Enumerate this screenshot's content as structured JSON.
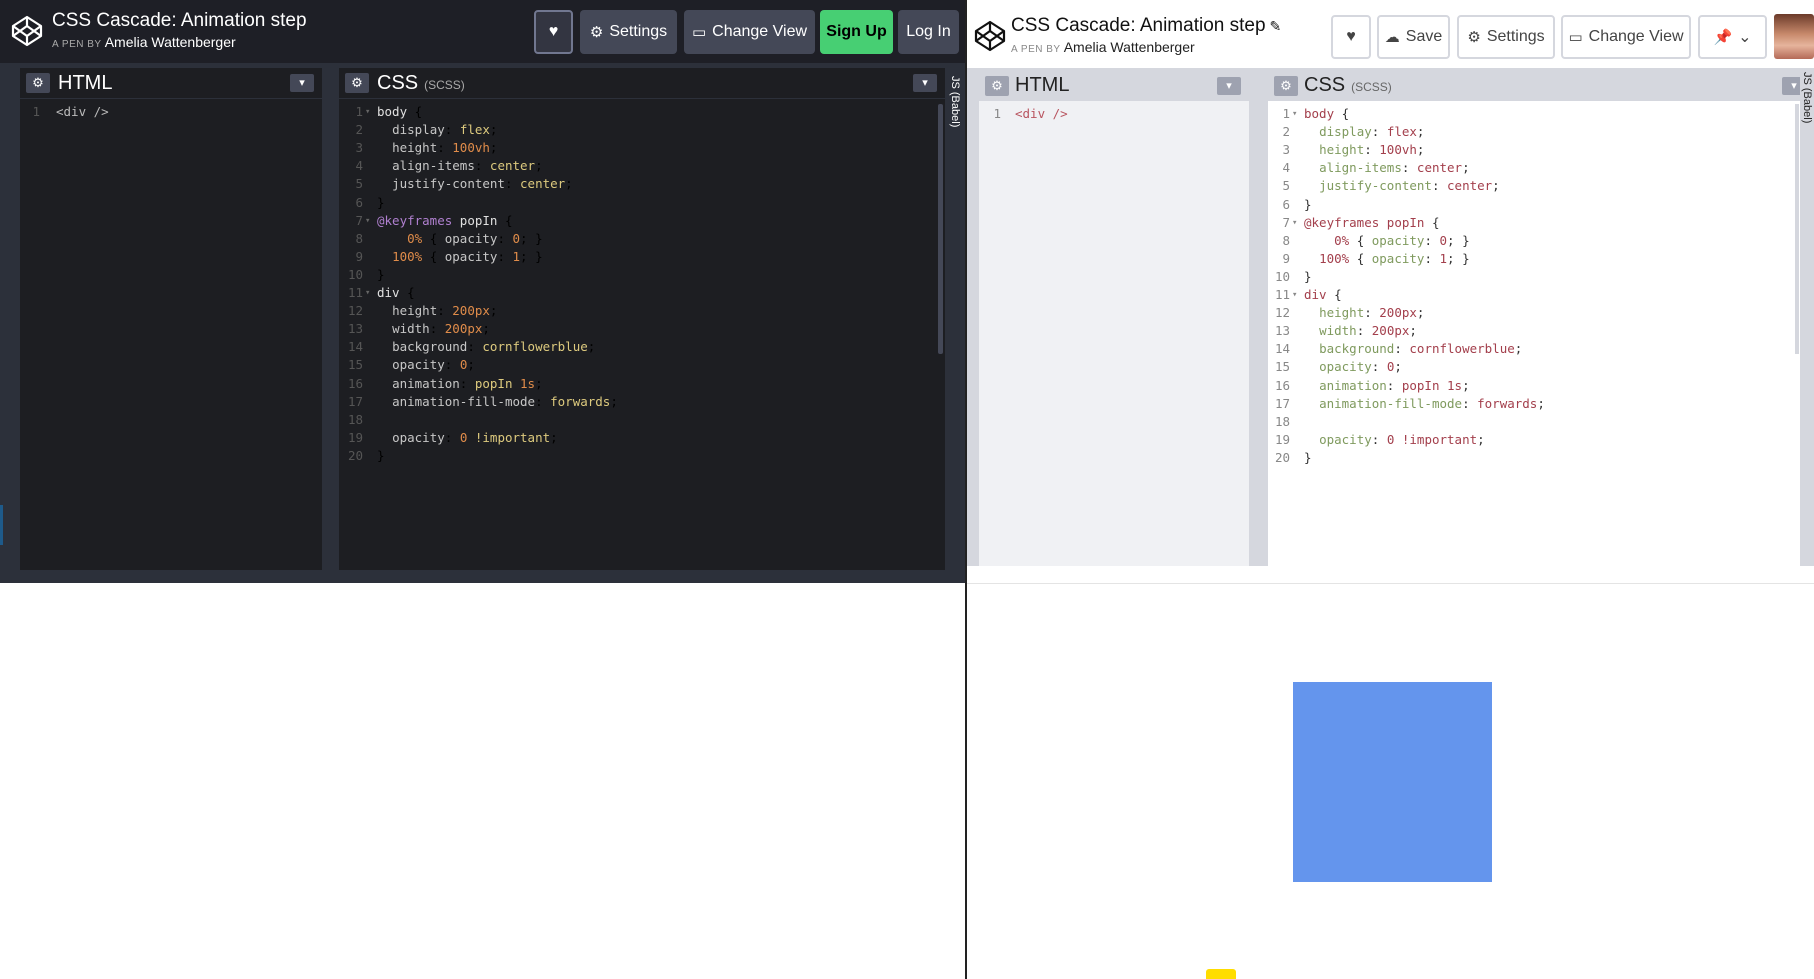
{
  "left": {
    "title": "CSS Cascade: Animation step",
    "byline_prefix": "A PEN BY",
    "author": "Amelia Wattenberger",
    "buttons": {
      "heart": "♥",
      "settings": "Settings",
      "change_view": "Change View",
      "sign_up": "Sign Up",
      "log_in": "Log In"
    },
    "html_panel": {
      "label": "HTML"
    },
    "css_panel": {
      "label": "CSS",
      "sublabel": "(SCSS)"
    },
    "js_strip": "JS (Babel)"
  },
  "right": {
    "title": "CSS Cascade: Animation step",
    "byline_prefix": "A PEN BY",
    "author": "Amelia Wattenberger",
    "buttons": {
      "heart": "♥",
      "save": "Save",
      "settings": "Settings",
      "change_view": "Change View"
    },
    "html_panel": {
      "label": "HTML"
    },
    "css_panel": {
      "label": "CSS",
      "sublabel": "(SCSS)"
    },
    "js_strip": "JS (Babel)",
    "preview_box_color": "#6495ED"
  },
  "html_code": [
    {
      "n": "1",
      "text": "<div />"
    }
  ],
  "css_code": [
    {
      "n": "1",
      "fold": true,
      "parts": [
        [
          "sel",
          "body "
        ],
        [
          "plain",
          "{"
        ]
      ]
    },
    {
      "n": "2",
      "parts": [
        [
          "plain",
          "  "
        ],
        [
          "prop",
          "display"
        ],
        [
          "plain",
          ": "
        ],
        [
          "val",
          "flex"
        ],
        [
          "plain",
          ";"
        ]
      ]
    },
    {
      "n": "3",
      "parts": [
        [
          "plain",
          "  "
        ],
        [
          "prop",
          "height"
        ],
        [
          "plain",
          ": "
        ],
        [
          "numv",
          "100vh"
        ],
        [
          "plain",
          ";"
        ]
      ]
    },
    {
      "n": "4",
      "parts": [
        [
          "plain",
          "  "
        ],
        [
          "prop",
          "align-items"
        ],
        [
          "plain",
          ": "
        ],
        [
          "val",
          "center"
        ],
        [
          "plain",
          ";"
        ]
      ]
    },
    {
      "n": "5",
      "parts": [
        [
          "plain",
          "  "
        ],
        [
          "prop",
          "justify-content"
        ],
        [
          "plain",
          ": "
        ],
        [
          "val",
          "center"
        ],
        [
          "plain",
          ";"
        ]
      ]
    },
    {
      "n": "6",
      "parts": [
        [
          "plain",
          "}"
        ]
      ]
    },
    {
      "n": "7",
      "fold": true,
      "parts": [
        [
          "at",
          "@keyframes "
        ],
        [
          "sel",
          "popIn "
        ],
        [
          "plain",
          "{"
        ]
      ]
    },
    {
      "n": "8",
      "parts": [
        [
          "plain",
          "    "
        ],
        [
          "numv",
          "0%"
        ],
        [
          "plain",
          " { "
        ],
        [
          "prop",
          "opacity"
        ],
        [
          "plain",
          ": "
        ],
        [
          "numv",
          "0"
        ],
        [
          "plain",
          "; }"
        ]
      ]
    },
    {
      "n": "9",
      "parts": [
        [
          "plain",
          "  "
        ],
        [
          "numv",
          "100%"
        ],
        [
          "plain",
          " { "
        ],
        [
          "prop",
          "opacity"
        ],
        [
          "plain",
          ": "
        ],
        [
          "numv",
          "1"
        ],
        [
          "plain",
          "; }"
        ]
      ]
    },
    {
      "n": "10",
      "parts": [
        [
          "plain",
          "}"
        ]
      ]
    },
    {
      "n": "11",
      "fold": true,
      "parts": [
        [
          "sel",
          "div "
        ],
        [
          "plain",
          "{"
        ]
      ]
    },
    {
      "n": "12",
      "parts": [
        [
          "plain",
          "  "
        ],
        [
          "prop",
          "height"
        ],
        [
          "plain",
          ": "
        ],
        [
          "numv",
          "200px"
        ],
        [
          "plain",
          ";"
        ]
      ]
    },
    {
      "n": "13",
      "parts": [
        [
          "plain",
          "  "
        ],
        [
          "prop",
          "width"
        ],
        [
          "plain",
          ": "
        ],
        [
          "numv",
          "200px"
        ],
        [
          "plain",
          ";"
        ]
      ]
    },
    {
      "n": "14",
      "parts": [
        [
          "plain",
          "  "
        ],
        [
          "prop",
          "background"
        ],
        [
          "plain",
          ": "
        ],
        [
          "val",
          "cornflowerblue"
        ],
        [
          "plain",
          ";"
        ]
      ]
    },
    {
      "n": "15",
      "parts": [
        [
          "plain",
          "  "
        ],
        [
          "prop",
          "opacity"
        ],
        [
          "plain",
          ": "
        ],
        [
          "numv",
          "0"
        ],
        [
          "plain",
          ";"
        ]
      ]
    },
    {
      "n": "16",
      "parts": [
        [
          "plain",
          "  "
        ],
        [
          "prop",
          "animation"
        ],
        [
          "plain",
          ": "
        ],
        [
          "val",
          "popIn "
        ],
        [
          "numv",
          "1s"
        ],
        [
          "plain",
          ";"
        ]
      ]
    },
    {
      "n": "17",
      "parts": [
        [
          "plain",
          "  "
        ],
        [
          "prop",
          "animation-fill-mode"
        ],
        [
          "plain",
          ": "
        ],
        [
          "val",
          "forwards"
        ],
        [
          "plain",
          ";"
        ]
      ]
    },
    {
      "n": "18",
      "parts": []
    },
    {
      "n": "19",
      "parts": [
        [
          "plain",
          "  "
        ],
        [
          "prop",
          "opacity"
        ],
        [
          "plain",
          ": "
        ],
        [
          "numv",
          "0"
        ],
        [
          "plain",
          " "
        ],
        [
          "val",
          "!important"
        ],
        [
          "plain",
          ";"
        ]
      ]
    },
    {
      "n": "20",
      "parts": [
        [
          "plain",
          "}"
        ]
      ]
    }
  ]
}
